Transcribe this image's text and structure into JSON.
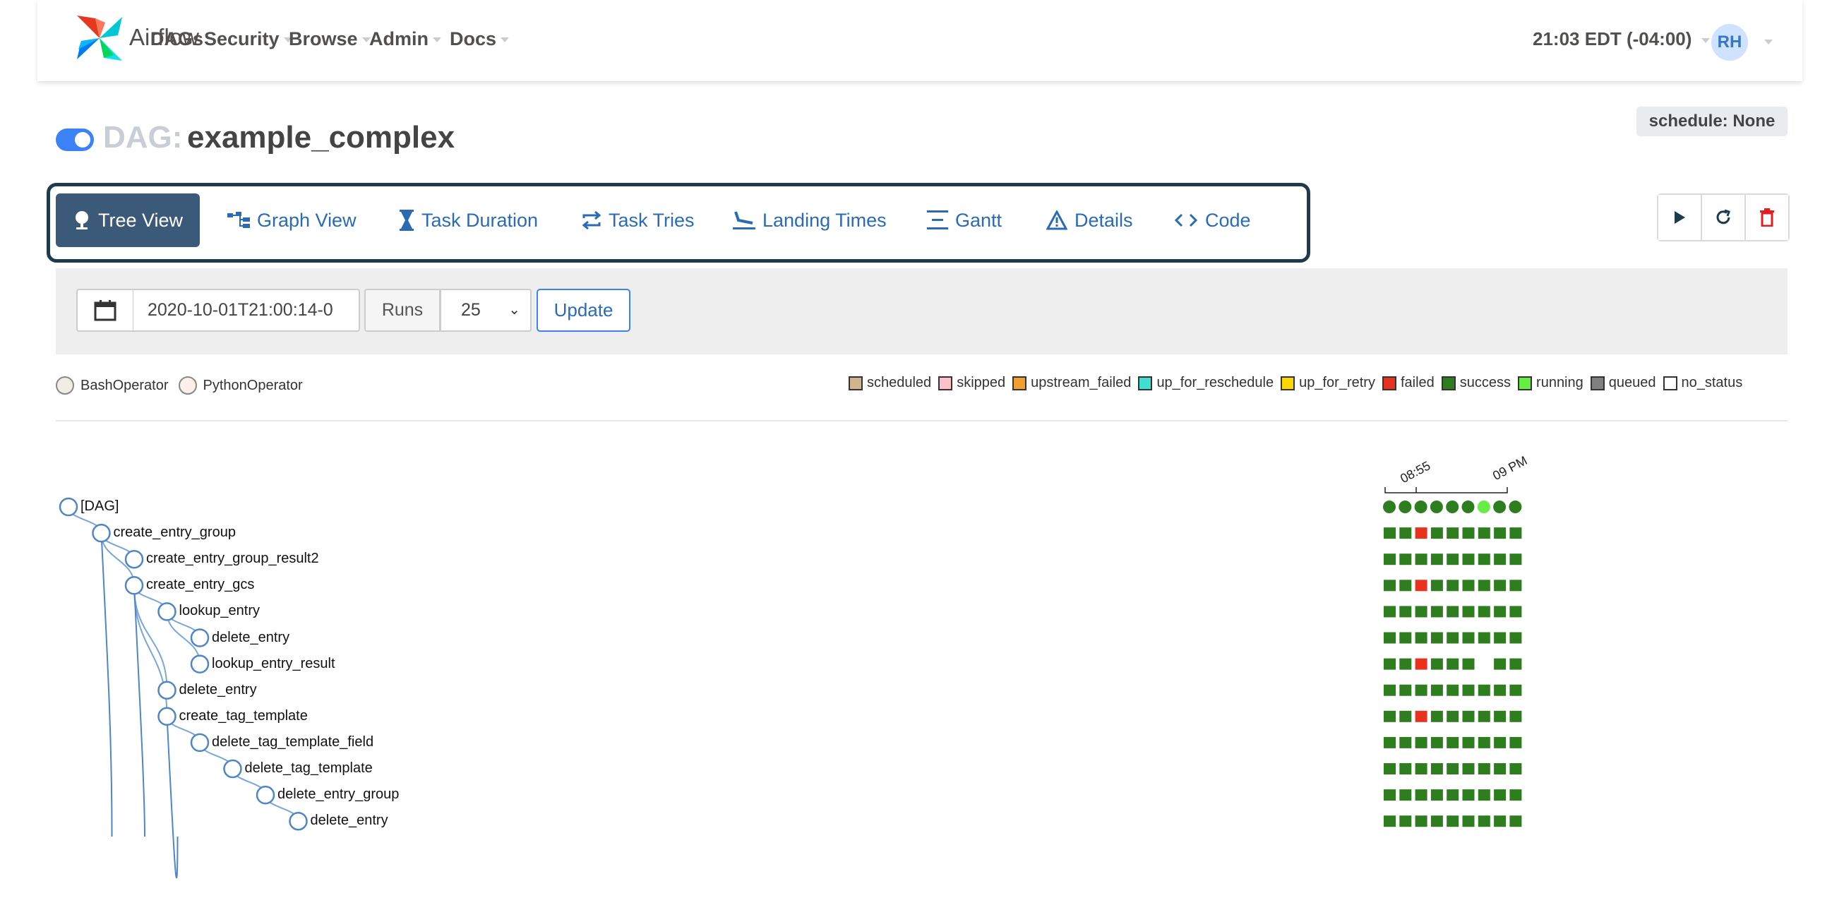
{
  "nav": {
    "brand": "Airflow",
    "items": [
      {
        "label": "DAGs",
        "dropdown": false
      },
      {
        "label": "Security",
        "dropdown": true
      },
      {
        "label": "Browse",
        "dropdown": true
      },
      {
        "label": "Admin",
        "dropdown": true
      },
      {
        "label": "Docs",
        "dropdown": true
      }
    ],
    "clock": "21:03 EDT (-04:00)",
    "user_initials": "RH"
  },
  "dag": {
    "prefix": "DAG:",
    "name": "example_complex",
    "schedule": "schedule: None",
    "paused": false
  },
  "tabs": [
    {
      "label": "Tree View",
      "icon": "tree-icon",
      "active": true
    },
    {
      "label": "Graph View",
      "icon": "graph-icon",
      "active": false
    },
    {
      "label": "Task Duration",
      "icon": "hourglass-icon",
      "active": false
    },
    {
      "label": "Task Tries",
      "icon": "repeat-icon",
      "active": false
    },
    {
      "label": "Landing Times",
      "icon": "plane-landing-icon",
      "active": false
    },
    {
      "label": "Gantt",
      "icon": "gantt-icon",
      "active": false
    },
    {
      "label": "Details",
      "icon": "warning-triangle-icon",
      "active": false
    },
    {
      "label": "Code",
      "icon": "code-icon",
      "active": false
    }
  ],
  "actions": [
    "play-icon",
    "refresh-icon",
    "trash-icon"
  ],
  "toolbar": {
    "base_date": "2020-10-01T21:00:14-0",
    "runs_label": "Runs",
    "runs_value": "25",
    "update_label": "Update"
  },
  "operators": [
    "BashOperator",
    "PythonOperator"
  ],
  "states": [
    {
      "label": "scheduled",
      "color": "#d2b48c"
    },
    {
      "label": "skipped",
      "color": "#ffc0cb"
    },
    {
      "label": "upstream_failed",
      "color": "#f0a030"
    },
    {
      "label": "up_for_reschedule",
      "color": "#40e0d0"
    },
    {
      "label": "up_for_retry",
      "color": "#ffd700"
    },
    {
      "label": "failed",
      "color": "#e8321e"
    },
    {
      "label": "success",
      "color": "#2e7d1f"
    },
    {
      "label": "running",
      "color": "#66ee44"
    },
    {
      "label": "queued",
      "color": "#808080"
    },
    {
      "label": "no_status",
      "color": "#ffffff"
    }
  ],
  "time_axis": [
    "08:55",
    "09 PM"
  ],
  "tree": [
    {
      "label": "[DAG]",
      "depth": 0
    },
    {
      "label": "create_entry_group",
      "depth": 1
    },
    {
      "label": "create_entry_group_result2",
      "depth": 2
    },
    {
      "label": "create_entry_gcs",
      "depth": 2
    },
    {
      "label": "lookup_entry",
      "depth": 3
    },
    {
      "label": "delete_entry",
      "depth": 4
    },
    {
      "label": "lookup_entry_result",
      "depth": 4
    },
    {
      "label": "delete_entry",
      "depth": 3
    },
    {
      "label": "create_tag_template",
      "depth": 3
    },
    {
      "label": "delete_tag_template_field",
      "depth": 4
    },
    {
      "label": "delete_tag_template",
      "depth": 5
    },
    {
      "label": "delete_entry_group",
      "depth": 6
    },
    {
      "label": "delete_entry",
      "depth": 7
    }
  ],
  "grid": [
    [
      "S",
      "S",
      "S",
      "S",
      "S",
      "S",
      "R",
      "S",
      "S"
    ],
    [
      "S",
      "S",
      "F",
      "S",
      "S",
      "S",
      "S",
      "S",
      "S"
    ],
    [
      "S",
      "S",
      "S",
      "S",
      "S",
      "S",
      "S",
      "S",
      "S"
    ],
    [
      "S",
      "S",
      "F",
      "S",
      "S",
      "S",
      "S",
      "S",
      "S"
    ],
    [
      "S",
      "S",
      "S",
      "S",
      "S",
      "S",
      "S",
      "S",
      "S"
    ],
    [
      "S",
      "S",
      "S",
      "S",
      "S",
      "S",
      "S",
      "S",
      "S"
    ],
    [
      "S",
      "S",
      "F",
      "S",
      "S",
      "S",
      "N",
      "S",
      "S"
    ],
    [
      "S",
      "S",
      "S",
      "S",
      "S",
      "S",
      "S",
      "S",
      "S"
    ],
    [
      "S",
      "S",
      "F",
      "S",
      "S",
      "S",
      "S",
      "S",
      "S"
    ],
    [
      "S",
      "S",
      "S",
      "S",
      "S",
      "S",
      "S",
      "S",
      "S"
    ],
    [
      "S",
      "S",
      "S",
      "S",
      "S",
      "S",
      "S",
      "S",
      "S"
    ],
    [
      "S",
      "S",
      "S",
      "S",
      "S",
      "S",
      "S",
      "S",
      "S"
    ],
    [
      "S",
      "S",
      "S",
      "S",
      "S",
      "S",
      "S",
      "S",
      "S"
    ]
  ]
}
